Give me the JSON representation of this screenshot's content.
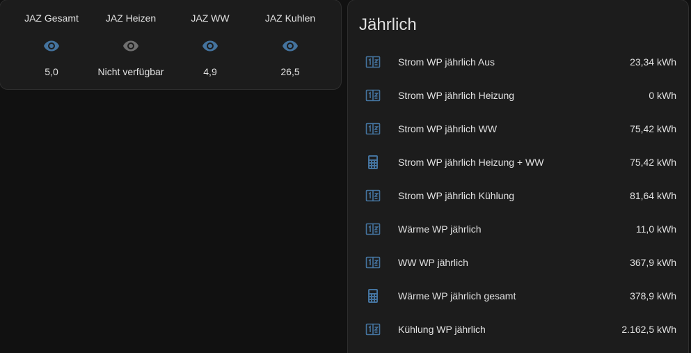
{
  "glance": {
    "items": [
      {
        "name": "JAZ Gesamt",
        "state": "5,0",
        "icon": "eye-icon",
        "available": true
      },
      {
        "name": "JAZ Heizen",
        "state": "Nicht verfügbar",
        "icon": "eye-icon",
        "available": false
      },
      {
        "name": "JAZ WW",
        "state": "4,9",
        "icon": "eye-icon",
        "available": true
      },
      {
        "name": "JAZ Kuhlen",
        "state": "26,5",
        "icon": "eye-icon",
        "available": true
      }
    ]
  },
  "entities": {
    "title": "Jährlich",
    "rows": [
      {
        "name": "Strom WP jährlich Aus",
        "value": "23,34 kWh",
        "icon": "counter-icon"
      },
      {
        "name": "Strom WP jährlich Heizung",
        "value": "0 kWh",
        "icon": "counter-icon"
      },
      {
        "name": "Strom WP jährlich WW",
        "value": "75,42 kWh",
        "icon": "counter-icon"
      },
      {
        "name": "Strom WP jährlich Heizung + WW",
        "value": "75,42 kWh",
        "icon": "calculator-icon"
      },
      {
        "name": "Strom WP jährlich Kühlung",
        "value": "81,64 kWh",
        "icon": "counter-icon"
      },
      {
        "name": "Wärme WP jährlich",
        "value": "11,0 kWh",
        "icon": "counter-icon"
      },
      {
        "name": "WW WP jährlich",
        "value": "367,9 kWh",
        "icon": "counter-icon"
      },
      {
        "name": "Wärme WP jährlich gesamt",
        "value": "378,9 kWh",
        "icon": "calculator-icon"
      },
      {
        "name": "Kühlung WP jährlich",
        "value": "2.162,5 kWh",
        "icon": "counter-icon"
      }
    ]
  },
  "colors": {
    "background": "#111111",
    "card": "#1c1c1c",
    "icon_active": "#44739e",
    "icon_unavailable": "#6f6f6f",
    "text": "#e1e1e1"
  }
}
